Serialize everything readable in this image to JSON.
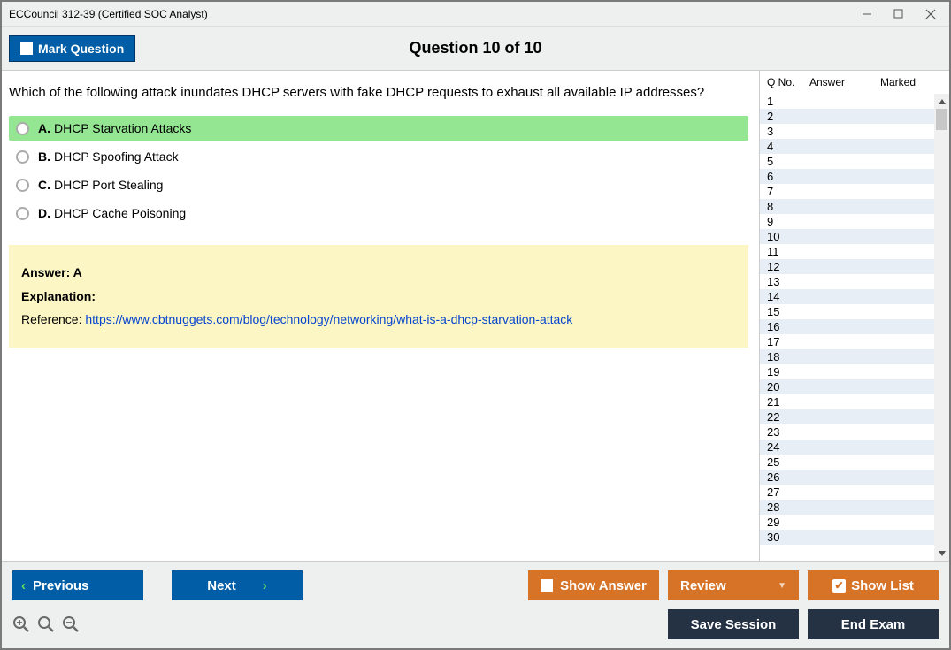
{
  "titlebar": {
    "title": "ECCouncil 312-39 (Certified SOC Analyst)"
  },
  "header": {
    "mark_label": "Mark Question",
    "question_title": "Question 10 of 10"
  },
  "question": {
    "text": "Which of the following attack inundates DHCP servers with fake DHCP requests to exhaust all available IP addresses?",
    "options": [
      {
        "letter": "A.",
        "text": "DHCP Starvation Attacks",
        "correct": true
      },
      {
        "letter": "B.",
        "text": "DHCP Spoofing Attack",
        "correct": false
      },
      {
        "letter": "C.",
        "text": "DHCP Port Stealing",
        "correct": false
      },
      {
        "letter": "D.",
        "text": "DHCP Cache Poisoning",
        "correct": false
      }
    ]
  },
  "explanation": {
    "answer_label": "Answer: A",
    "expl_label": "Explanation:",
    "ref_label": "Reference: ",
    "ref_url": "https://www.cbtnuggets.com/blog/technology/networking/what-is-a-dhcp-starvation-attack"
  },
  "sidebar": {
    "headers": {
      "qno": "Q No.",
      "answer": "Answer",
      "marked": "Marked"
    },
    "rows": [
      1,
      2,
      3,
      4,
      5,
      6,
      7,
      8,
      9,
      10,
      11,
      12,
      13,
      14,
      15,
      16,
      17,
      18,
      19,
      20,
      21,
      22,
      23,
      24,
      25,
      26,
      27,
      28,
      29,
      30
    ]
  },
  "footer": {
    "previous": "Previous",
    "next": "Next",
    "show_answer": "Show Answer",
    "review": "Review",
    "show_list": "Show List",
    "save_session": "Save Session",
    "end_exam": "End Exam"
  }
}
